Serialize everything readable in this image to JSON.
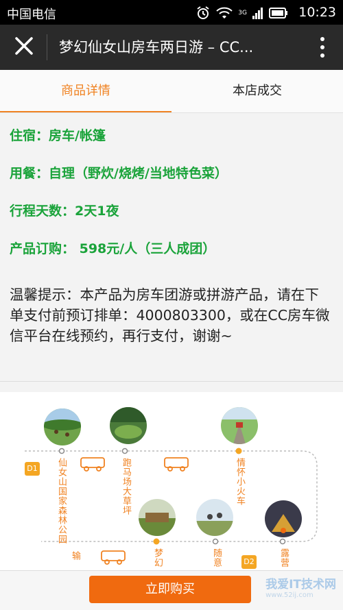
{
  "status_bar": {
    "carrier": "中国电信",
    "time": "10:23",
    "network": "3G"
  },
  "app_bar": {
    "title": "梦幻仙女山房车两日游 – CC..."
  },
  "tabs": [
    {
      "label": "商品详情"
    },
    {
      "label": "本店成交"
    }
  ],
  "details": {
    "lodging": "住宿：房车/帐篷",
    "meals": "用餐：自理（野炊/烧烤/当地特色菜）",
    "duration": "行程天数：2天1夜",
    "price": "产品订购： 598元/人（三人成团）",
    "tip": "温馨提示：本产品为房车团游或拼游产品，请在下单支付前预订排单：4000803300，或在CC房车微信平台在线预约，再行支付，谢谢~"
  },
  "route": {
    "day_labels": [
      "D1",
      "D2"
    ],
    "stops": [
      "仙女山国家森林公园",
      "跑马场大草坪",
      "情怀小火车",
      "梦幻",
      "随意",
      "露营",
      "输"
    ]
  },
  "buy_button": {
    "label": "立即购买"
  },
  "watermark": {
    "text": "我爱IT技术网",
    "url": "www.52ij.com"
  },
  "colors": {
    "accent": "#f08221",
    "green": "#1aa33a",
    "buy": "#f06a0f",
    "appbar": "#2a2a2a"
  }
}
